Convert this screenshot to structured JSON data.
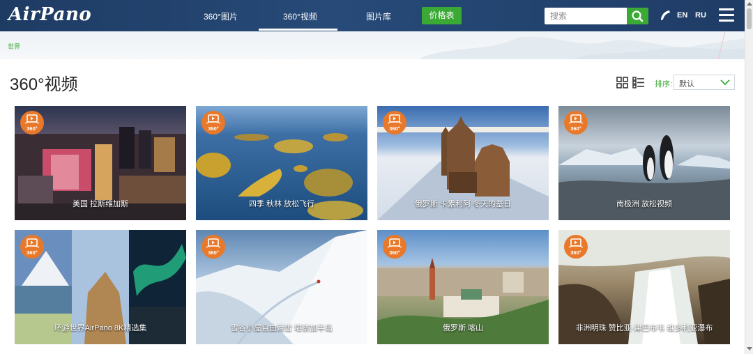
{
  "header": {
    "logo": "AirPano",
    "nav": [
      {
        "label": "360°图片",
        "active": false
      },
      {
        "label": "360°视频",
        "active": true
      },
      {
        "label": "图片库",
        "active": false
      }
    ],
    "price_button": "价格表",
    "search_placeholder": "搜索",
    "languages": [
      "EN",
      "RU"
    ]
  },
  "breadcrumb": "世界",
  "page_title": "360°视频",
  "sort": {
    "label": "排序:",
    "selected": "默认"
  },
  "badge_text": "360°",
  "cards": [
    {
      "caption": "美国 拉斯维加斯",
      "thumb": "city-night"
    },
    {
      "caption": "四季 秋林 放松飞行",
      "thumb": "autumn-lake-islands"
    },
    {
      "caption": "俄罗斯 卡累利阿 冬天的基日",
      "thumb": "winter-wooden-church"
    },
    {
      "caption": "南极洲 放松视频",
      "thumb": "antarctic-penguins"
    },
    {
      "caption": "环游世界AirPano 8K精选集",
      "thumb": "collage-mountain-rock-aurora"
    },
    {
      "caption": "雪谷小屋自由滑雪 堪察加半岛",
      "thumb": "snow-mountain-skier"
    },
    {
      "caption": "俄罗斯 喀山",
      "thumb": "kremlin-city-aerial"
    },
    {
      "caption": "非洲明珠 赞比亚-津巴布韦 维多利亚瀑布",
      "thumb": "waterfall"
    }
  ],
  "colors": {
    "header_bg": "#234573",
    "accent_green": "#3aaa35",
    "badge_orange": "#e8792b"
  }
}
